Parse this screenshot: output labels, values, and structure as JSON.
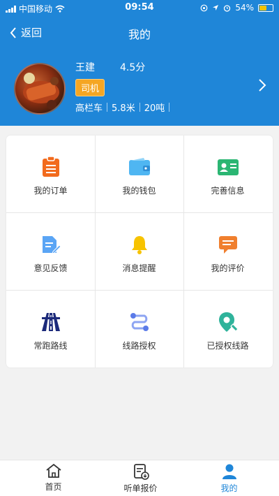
{
  "status_bar": {
    "carrier": "中国移动",
    "time": "09:54",
    "battery": "54%",
    "battery_level": 0.54
  },
  "nav": {
    "back_label": "返回",
    "title": "我的"
  },
  "profile": {
    "name": "王建",
    "score": "4.5分",
    "role": "司机",
    "vehicle_type": "高栏车",
    "vehicle_length": "5.8米",
    "vehicle_capacity": "20吨"
  },
  "menu": [
    {
      "label": "我的订单",
      "icon": "clipboard-icon",
      "color": "#f26b1d"
    },
    {
      "label": "我的钱包",
      "icon": "wallet-icon",
      "color": "#4fb6f2"
    },
    {
      "label": "完善信息",
      "icon": "id-card-icon",
      "color": "#2bb673"
    },
    {
      "label": "意见反馈",
      "icon": "feedback-document-icon",
      "color": "#5aa5f5"
    },
    {
      "label": "消息提醒",
      "icon": "bell-icon",
      "color": "#f7c300"
    },
    {
      "label": "我的评价",
      "icon": "comment-icon",
      "color": "#f07f2e"
    },
    {
      "label": "常跑路线",
      "icon": "highway-icon",
      "color": "#1c2a7a"
    },
    {
      "label": "线路授权",
      "icon": "route-icon",
      "color": "#5b7be8"
    },
    {
      "label": "已授权线路",
      "icon": "map-pin-icon",
      "color": "#2fb39b"
    }
  ],
  "tabbar": [
    {
      "label": "首页",
      "icon": "home-icon"
    },
    {
      "label": "听单报价",
      "icon": "quote-list-icon"
    },
    {
      "label": "我的",
      "icon": "user-icon"
    }
  ],
  "colors": {
    "header": "#1f86d8",
    "role_badge": "#f5a623",
    "active_tab": "#1f86d8"
  }
}
